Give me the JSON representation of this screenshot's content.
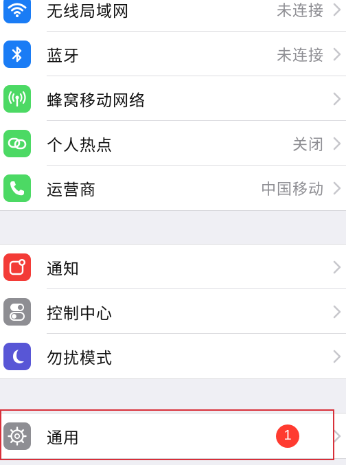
{
  "groups": [
    {
      "items": [
        {
          "label": "无线局域网",
          "value": "未连接",
          "icon": "wifi-icon",
          "color": "#1a7cf5"
        },
        {
          "label": "蓝牙",
          "value": "未连接",
          "icon": "bluetooth-icon",
          "color": "#1a7cf5"
        },
        {
          "label": "蜂窝移动网络",
          "value": "",
          "icon": "cellular-antenna-icon",
          "color": "#4cd964"
        },
        {
          "label": "个人热点",
          "value": "关闭",
          "icon": "personal-hotspot-icon",
          "color": "#4cd964"
        },
        {
          "label": "运营商",
          "value": "中国移动",
          "icon": "phone-icon",
          "color": "#4cd964"
        }
      ]
    },
    {
      "items": [
        {
          "label": "通知",
          "value": "",
          "icon": "notifications-icon",
          "color": "#f33b37"
        },
        {
          "label": "控制中心",
          "value": "",
          "icon": "control-center-icon",
          "color": "#8e8e93"
        },
        {
          "label": "勿扰模式",
          "value": "",
          "icon": "moon-icon",
          "color": "#5856d6"
        }
      ]
    },
    {
      "items": [
        {
          "label": "通用",
          "value": "",
          "badge": "1",
          "icon": "gear-icon",
          "color": "#8e8e93"
        }
      ]
    }
  ],
  "colors": {
    "chevron": "#c7c7cc",
    "highlight_border": "#d8303a"
  }
}
